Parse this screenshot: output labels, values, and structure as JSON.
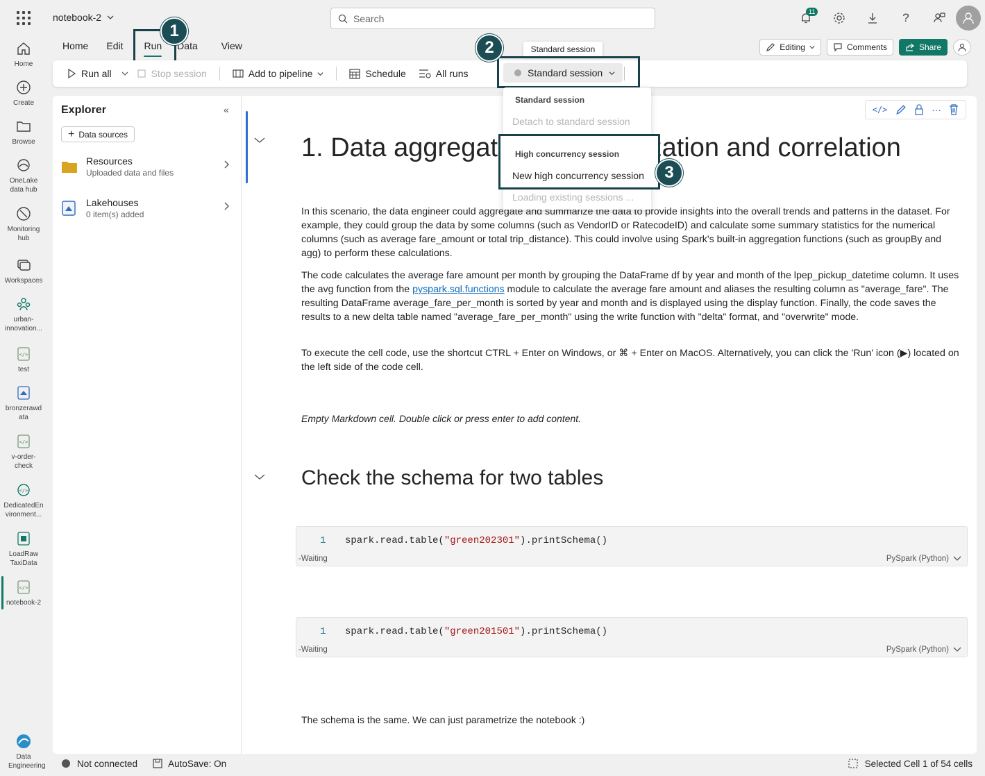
{
  "header": {
    "notebook_name": "notebook-2",
    "search_placeholder": "Search",
    "notification_count": "11"
  },
  "rail": [
    {
      "label": "Home",
      "icon": "home-icon"
    },
    {
      "label": "Create",
      "icon": "plus-circle-icon"
    },
    {
      "label": "Browse",
      "icon": "folder-icon"
    },
    {
      "label": "OneLake data hub",
      "icon": "onelake-icon"
    },
    {
      "label": "Monitoring hub",
      "icon": "monitor-icon"
    },
    {
      "label": "Workspaces",
      "icon": "workspaces-icon"
    },
    {
      "label": "urban-innovation...",
      "icon": "workspace-people-icon"
    },
    {
      "label": "test",
      "icon": "notebook-icon"
    },
    {
      "label": "bronzerawdata",
      "icon": "lakehouse-icon"
    },
    {
      "label": "v-order-check",
      "icon": "notebook-icon"
    },
    {
      "label": "DedicatedEnvironment...",
      "icon": "environment-icon"
    },
    {
      "label": "LoadRawTaxiData",
      "icon": "pipeline-icon"
    },
    {
      "label": "notebook-2",
      "icon": "notebook-icon"
    },
    {
      "label": "Data Engineering",
      "icon": "data-engineering-icon"
    }
  ],
  "ribbon": {
    "tabs": [
      "Home",
      "Edit",
      "Run",
      "Data",
      "View"
    ],
    "active_tab": "Run",
    "editing": "Editing",
    "comments": "Comments",
    "share": "Share"
  },
  "toolbar": {
    "run_all": "Run all",
    "stop_session": "Stop session",
    "add_to_pipeline": "Add to pipeline",
    "schedule": "Schedule",
    "all_runs": "All runs"
  },
  "session": {
    "tooltip": "Standard session",
    "button_label": "Standard session",
    "menu": {
      "standard_header": "Standard session",
      "detach": "Detach to standard session",
      "hc_header": "High concurrency session",
      "new_hc": "New high concurrency session",
      "loading": "Loading existing sessions ..."
    }
  },
  "explorer": {
    "title": "Explorer",
    "data_sources": "Data sources",
    "items": [
      {
        "title": "Resources",
        "subtitle": "Uploaded data and files"
      },
      {
        "title": "Lakehouses",
        "subtitle": "0 item(s) added"
      }
    ]
  },
  "notebook": {
    "heading": "1. Data aggregation, summarization and correlation",
    "p1": "In this scenario, the data engineer could aggregate and summarize the data to provide insights into the overall trends and patterns in the dataset. For example, they could group the data by some columns (such as VendorID or RatecodeID) and calculate some summary statistics for the numerical columns (such as average fare_amount or total trip_distance). This could involve using Spark's built-in aggregation functions (such as groupBy and agg) to perform these calculations.",
    "p2a": "The code calculates the average fare amount per month by grouping the DataFrame df by year and month of the lpep_pickup_datetime column. It uses the avg function from the ",
    "p2_link": "pyspark.sql.functions",
    "p2b": " module to calculate the average fare amount and aliases the resulting column as \"average_fare\". The resulting DataFrame average_fare_per_month is sorted by year and month and is displayed using the display function. Finally, the code saves the results to a new delta table named \"average_fare_per_month\" using the write function with \"delta\" format, and \"overwrite\" mode.",
    "p3": "To execute the cell code, use the shortcut CTRL + Enter on Windows, or ⌘ + Enter on MacOS. Alternatively, you can click the 'Run' icon (▶) located on the left side of the code cell.",
    "empty_md": "Empty Markdown cell. Double click or press enter to add content.",
    "heading2": "Check the schema for two tables",
    "cells": [
      {
        "line": "1",
        "pre": "spark.read.table(",
        "str": "\"green202301\"",
        "post": ").printSchema()",
        "status": "-Waiting",
        "lang": "PySpark (Python)"
      },
      {
        "line": "1",
        "pre": "spark.read.table(",
        "str": "\"green201501\"",
        "post": ").printSchema()",
        "status": "-Waiting",
        "lang": "PySpark (Python)"
      }
    ],
    "closing": "The schema is the same. We can just parametrize the notebook :)"
  },
  "status": {
    "connection": "Not connected",
    "autosave": "AutoSave: On",
    "selection": "Selected Cell 1 of 54 cells"
  },
  "callouts": [
    "1",
    "2",
    "3"
  ]
}
